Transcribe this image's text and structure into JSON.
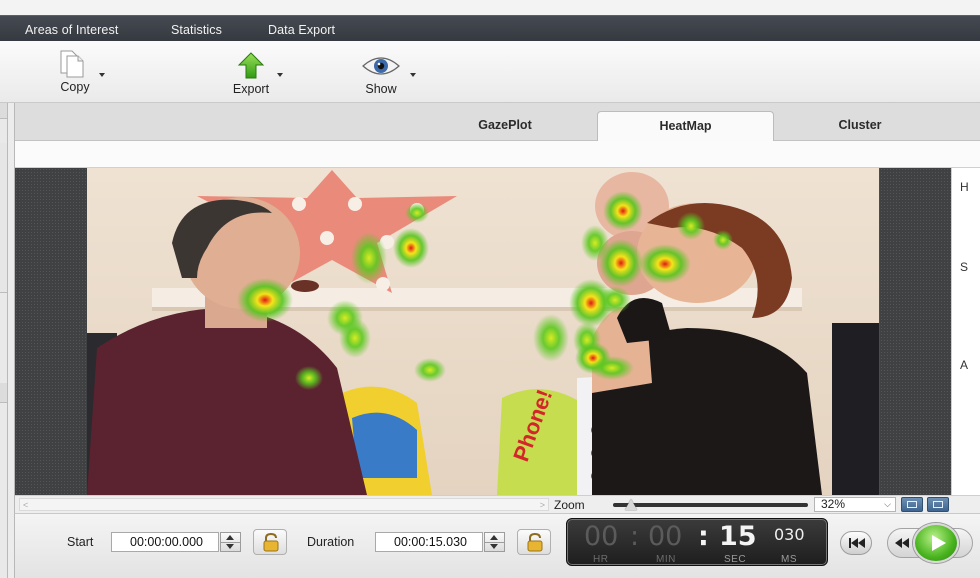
{
  "menubar": {
    "items": [
      "Areas of Interest",
      "Statistics",
      "Data Export"
    ]
  },
  "toolbar": {
    "copy_label": "Copy",
    "export_label": "Export",
    "show_label": "Show"
  },
  "tabs": [
    "GazePlot",
    "HeatMap",
    "Cluster"
  ],
  "active_tab": "HeatMap",
  "right_panel": {
    "labels": [
      "H",
      "S",
      "A"
    ]
  },
  "zoom": {
    "label": "Zoom",
    "value": "32%",
    "level": 0.08
  },
  "playback": {
    "start_label": "Start",
    "start_value": "00:00:00.000",
    "duration_label": "Duration",
    "duration_value": "00:00:15.030",
    "clock": {
      "hr": "00",
      "min": "00",
      "sec": "15",
      "ms": "030"
    },
    "clock_units": {
      "hr": "HR",
      "min": "MIN",
      "sec": "SEC",
      "ms": "MS"
    }
  },
  "scene_toy_text": "Phone!",
  "colors": {
    "menubar": "#3d4148",
    "play_green": "#48b31d",
    "heat_red": "#e3201a",
    "heat_yellow": "#f5e81c",
    "heat_green": "#57c61f"
  }
}
